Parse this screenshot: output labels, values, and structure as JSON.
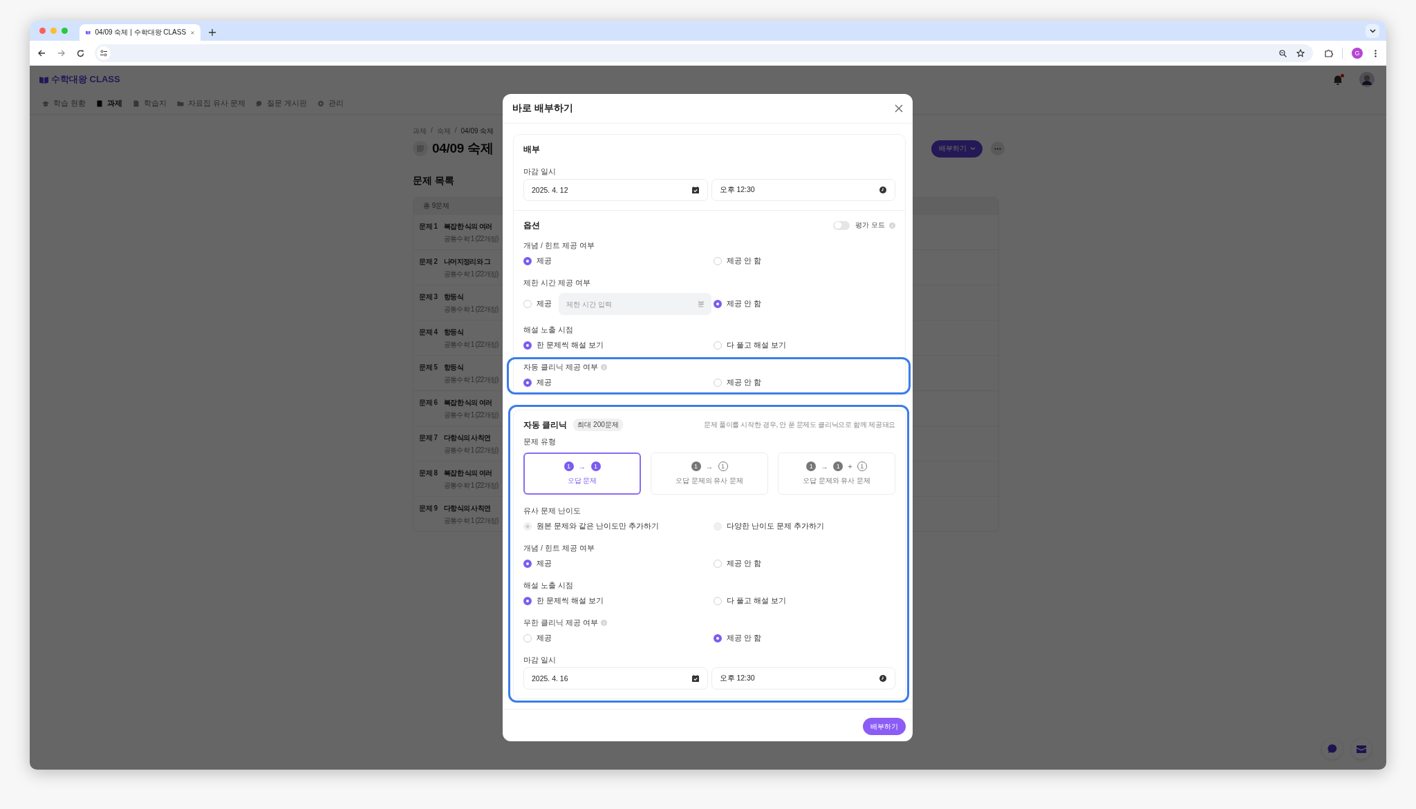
{
  "browser": {
    "tab_title": "04/09 숙제 | 수학대왕 CLASS",
    "profile_initial": "G"
  },
  "app": {
    "logo": "수학대왕 CLASS",
    "notification": true,
    "nav": [
      {
        "label": "학습 현황",
        "selected": false
      },
      {
        "label": "과제",
        "selected": true
      },
      {
        "label": "학습지",
        "selected": false
      },
      {
        "label": "자료집 유사 문제",
        "selected": false
      },
      {
        "label": "질문 게시판",
        "selected": false
      },
      {
        "label": "관리",
        "selected": false
      }
    ]
  },
  "page": {
    "breadcrumb": [
      "과제",
      "숙제",
      "04/09 숙제"
    ],
    "breadcrumb_separator": "/",
    "title": "04/09 숙제",
    "action_button": "배부하기"
  },
  "problem_list": {
    "heading": "문제 목록",
    "count": "총 9문제",
    "rows": [
      {
        "number": "문제 1",
        "title": "복잡한 식의 여러",
        "subject": "공통수학 1 (22개정)"
      },
      {
        "number": "문제 2",
        "title": "나머지정리와 그",
        "subject": "공통수학 1 (22개정)"
      },
      {
        "number": "문제 3",
        "title": "항등식",
        "subject": "공통수학 1 (22개정)"
      },
      {
        "number": "문제 4",
        "title": "항등식",
        "subject": "공통수학 1 (22개정)"
      },
      {
        "number": "문제 5",
        "title": "항등식",
        "subject": "공통수학 1 (22개정)"
      },
      {
        "number": "문제 6",
        "title": "복잡한 식의 여러",
        "subject": "공통수학 1 (22개정)"
      },
      {
        "number": "문제 7",
        "title": "다항식의 사칙연",
        "subject": "공통수학 1 (22개정)"
      },
      {
        "number": "문제 8",
        "title": "복잡한 식의 여러",
        "subject": "공통수학 1 (22개정)"
      },
      {
        "number": "문제 9",
        "title": "다항식의 사칙연",
        "subject": "공통수학 1 (22개정)"
      }
    ]
  },
  "modal": {
    "title": "바로 배부하기",
    "distribute": {
      "heading": "배부",
      "deadline_label": "마감 일시",
      "date": "2025. 4. 12",
      "time": "오후 12:30"
    },
    "options": {
      "heading": "옵션",
      "eval_mode": {
        "label": "평가 모드",
        "on": false
      },
      "groups": [
        {
          "kind": "radio",
          "label": "개념 / 힌트 제공 여부",
          "info": false,
          "highlighted": false,
          "disabled": false,
          "options": [
            {
              "label": "제공",
              "selected": true
            },
            {
              "label": "제공 안 함",
              "selected": false
            }
          ]
        },
        {
          "kind": "time_limit",
          "label": "제한 시간 제공 여부",
          "info": false,
          "highlighted": false,
          "disabled": false,
          "options": [
            {
              "label": "제공",
              "selected": false
            },
            {
              "label": "제공 안 함",
              "selected": true
            }
          ],
          "input": {
            "placeholder": "제한 시간 입력",
            "unit": "분"
          }
        },
        {
          "kind": "radio",
          "label": "해설 노출 시점",
          "info": false,
          "highlighted": false,
          "disabled": false,
          "options": [
            {
              "label": "한 문제씩 해설 보기",
              "selected": true
            },
            {
              "label": "다 풀고 해설 보기",
              "selected": false
            }
          ]
        },
        {
          "kind": "radio",
          "label": "자동 클리닉 제공 여부",
          "info": true,
          "highlighted": true,
          "disabled": false,
          "options": [
            {
              "label": "제공",
              "selected": true
            },
            {
              "label": "제공 안 함",
              "selected": false
            }
          ]
        }
      ]
    },
    "clinic": {
      "heading": "자동 클리닉",
      "badge": "최대 200문제",
      "hint": "문제 풀이를 시작한 경우, 안 푼 문제도 클리닉으로 함께 제공돼요",
      "highlighted": true,
      "type_label": "문제 유형",
      "types": [
        {
          "label": "오답 문제",
          "selected": true,
          "tokens": [
            {
              "kind": "filled",
              "text": "1"
            },
            {
              "kind": "op",
              "text": "→"
            },
            {
              "kind": "filled",
              "text": "1"
            }
          ]
        },
        {
          "label": "오답 문제의 유사 문제",
          "selected": false,
          "tokens": [
            {
              "kind": "filled",
              "text": "1"
            },
            {
              "kind": "op",
              "text": "→"
            },
            {
              "kind": "outline",
              "text": "1"
            }
          ]
        },
        {
          "label": "오답 문제와 유사 문제",
          "selected": false,
          "tokens": [
            {
              "kind": "filled",
              "text": "1"
            },
            {
              "kind": "op",
              "text": "→"
            },
            {
              "kind": "filled",
              "text": "1"
            },
            {
              "kind": "op",
              "text": "+"
            },
            {
              "kind": "outline",
              "text": "1"
            }
          ]
        }
      ],
      "groups": [
        {
          "kind": "radio",
          "label": "유사 문제 난이도",
          "info": false,
          "disabled": true,
          "options": [
            {
              "label": "원본 문제와 같은 난이도만 추가하기",
              "selected": true
            },
            {
              "label": "다양한 난이도 문제 추가하기",
              "selected": false
            }
          ]
        },
        {
          "kind": "radio",
          "label": "개념 / 힌트 제공 여부",
          "info": false,
          "disabled": false,
          "options": [
            {
              "label": "제공",
              "selected": true
            },
            {
              "label": "제공 안 함",
              "selected": false
            }
          ]
        },
        {
          "kind": "radio",
          "label": "해설 노출 시점",
          "info": false,
          "disabled": false,
          "options": [
            {
              "label": "한 문제씩 해설 보기",
              "selected": true
            },
            {
              "label": "다 풀고 해설 보기",
              "selected": false
            }
          ]
        },
        {
          "kind": "radio",
          "label": "무한 클리닉 제공 여부",
          "info": true,
          "disabled": false,
          "options": [
            {
              "label": "제공",
              "selected": false
            },
            {
              "label": "제공 안 함",
              "selected": true
            }
          ]
        }
      ],
      "deadline_label": "마감 일시",
      "date": "2025. 4. 16",
      "time": "오후 12:30"
    },
    "submit": "배부하기"
  }
}
